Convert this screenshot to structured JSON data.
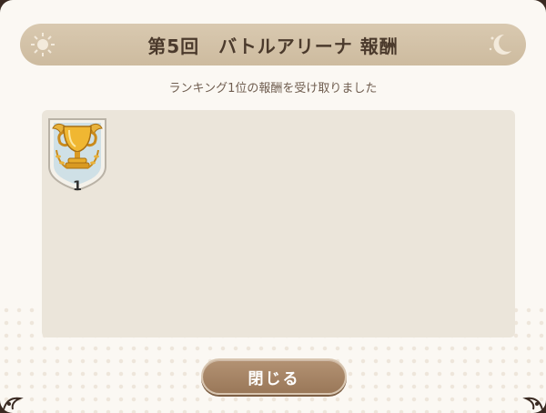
{
  "dialog": {
    "title": "第5回　バトルアリーナ 報酬",
    "message": "ランキング1位の報酬を受け取りました",
    "rewards": [
      {
        "icon": "gold-trophy-icon",
        "rank": "1"
      }
    ],
    "close_label": "閉じる"
  },
  "colors": {
    "banner": "#d9c9b0",
    "panel": "#ebe5da",
    "button": "#a6845f",
    "title_text": "#4b3a2c"
  }
}
